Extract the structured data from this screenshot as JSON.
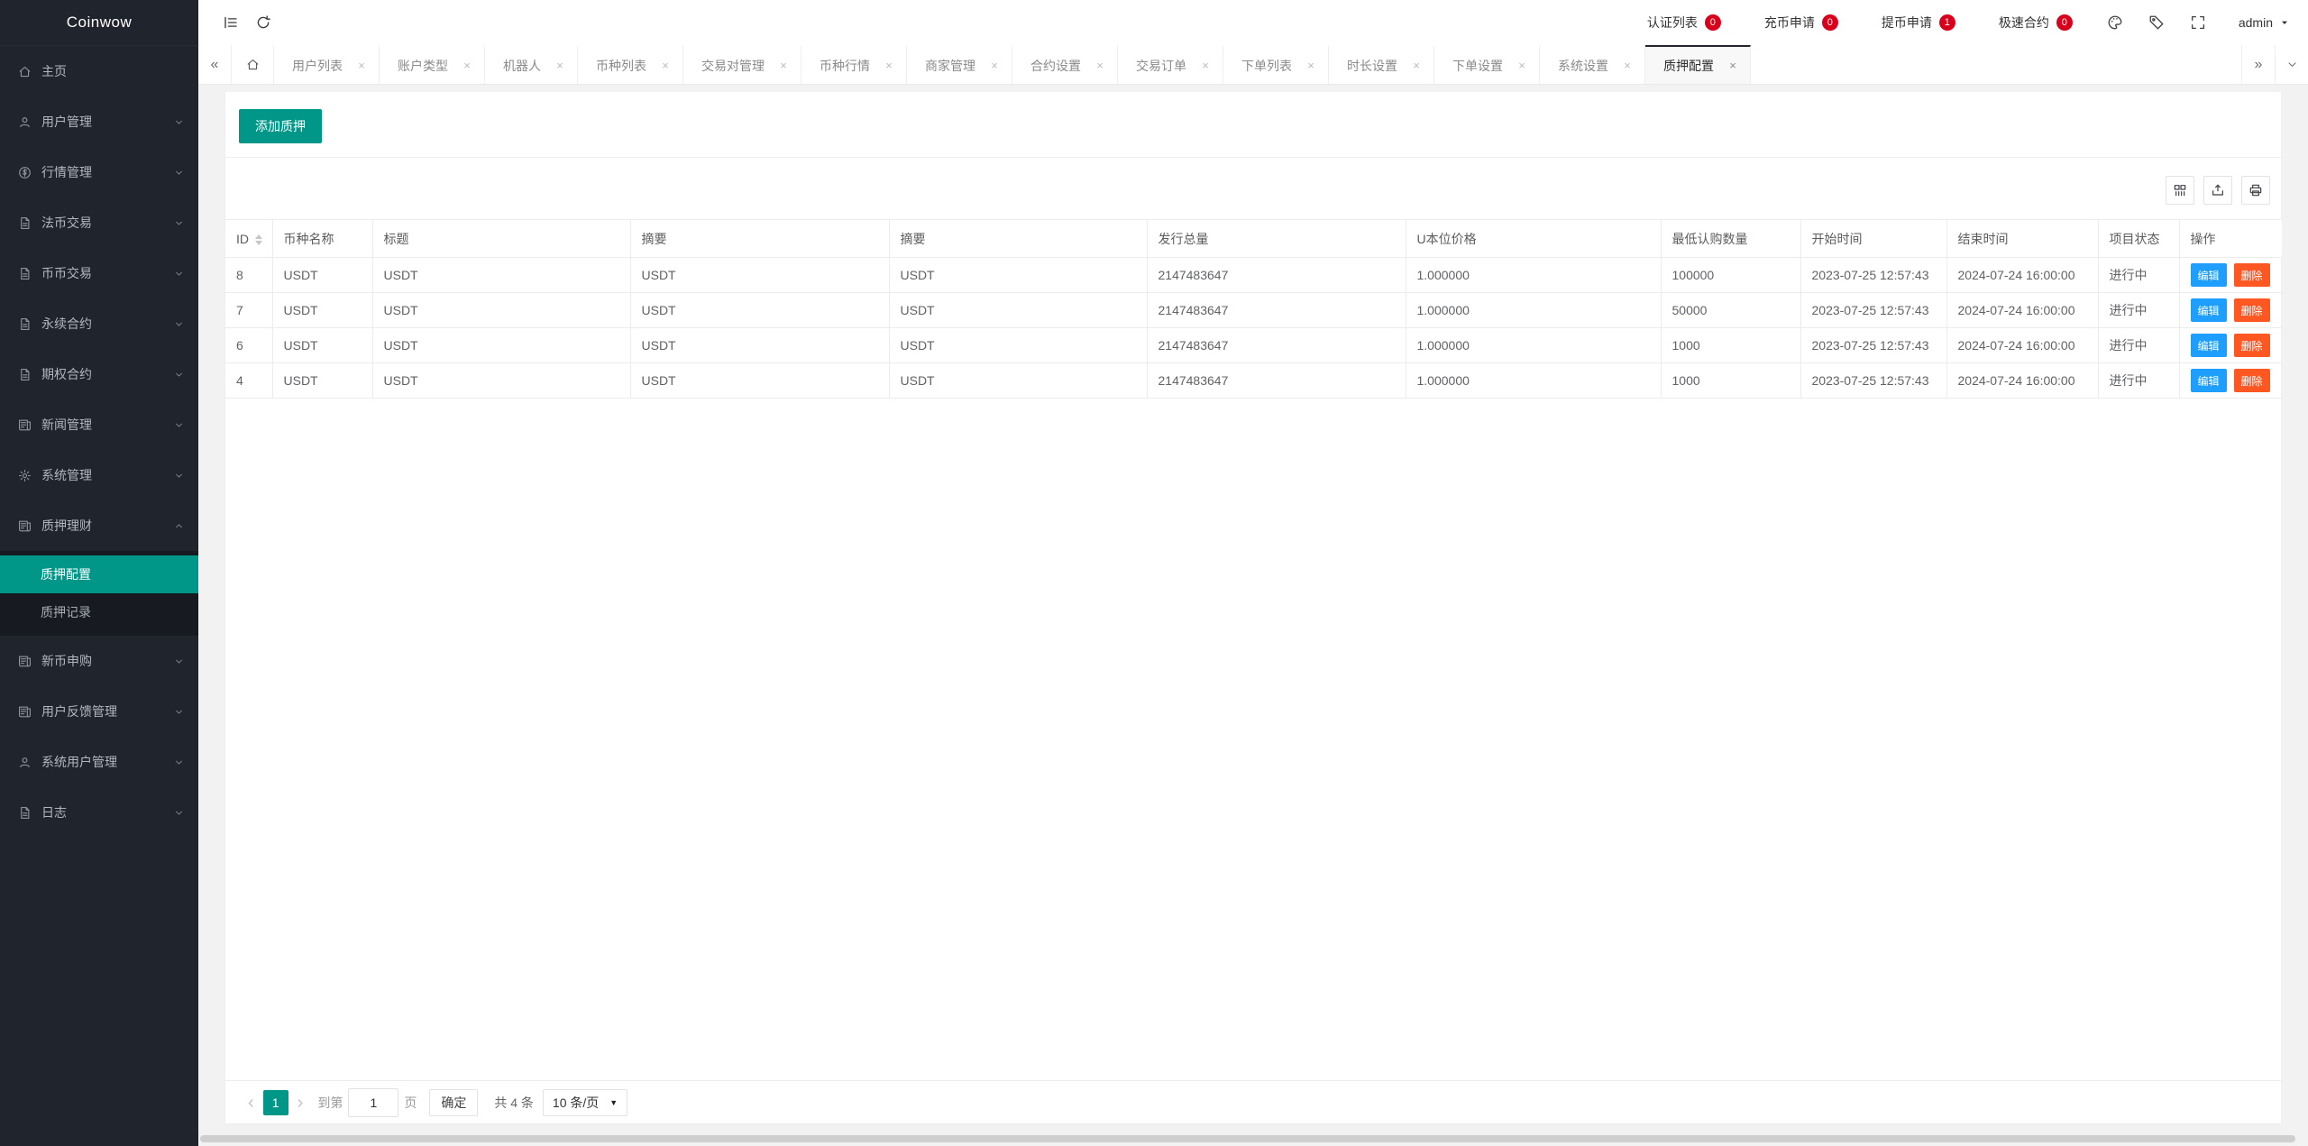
{
  "colors": {
    "accent": "#009688",
    "edit_button": "#1E9FFF",
    "delete_button": "#FF5722",
    "badge": "#d9001b",
    "sidebar_bg": "#20242c"
  },
  "sidebar": {
    "logo": "Coinwow",
    "items": [
      {
        "label": "主页",
        "icon": "home-icon",
        "expandable": false
      },
      {
        "label": "用户管理",
        "icon": "user-icon",
        "expandable": true
      },
      {
        "label": "行情管理",
        "icon": "dollar-circle-icon",
        "expandable": true
      },
      {
        "label": "法币交易",
        "icon": "file-icon",
        "expandable": true
      },
      {
        "label": "币币交易",
        "icon": "file-icon",
        "expandable": true
      },
      {
        "label": "永续合约",
        "icon": "file-icon",
        "expandable": true
      },
      {
        "label": "期权合约",
        "icon": "file-icon",
        "expandable": true
      },
      {
        "label": "新闻管理",
        "icon": "news-icon",
        "expandable": true
      },
      {
        "label": "系统管理",
        "icon": "gear-icon",
        "expandable": true
      },
      {
        "label": "质押理财",
        "icon": "news-icon",
        "expandable": true,
        "expanded": true,
        "children": [
          {
            "label": "质押配置",
            "active": true
          },
          {
            "label": "质押记录",
            "active": false
          }
        ]
      },
      {
        "label": "新币申购",
        "icon": "news-icon",
        "expandable": true
      },
      {
        "label": "用户反馈管理",
        "icon": "news-icon",
        "expandable": true
      },
      {
        "label": "系统用户管理",
        "icon": "user-icon",
        "expandable": true
      },
      {
        "label": "日志",
        "icon": "file-icon",
        "expandable": true
      }
    ]
  },
  "topbar": {
    "left_icons": [
      "collapse-menu-icon",
      "refresh-icon"
    ],
    "shortcuts": [
      {
        "label": "认证列表",
        "badge": "0"
      },
      {
        "label": "充币申请",
        "badge": "0"
      },
      {
        "label": "提币申请",
        "badge": "1"
      },
      {
        "label": "极速合约",
        "badge": "0"
      }
    ],
    "right_icons": [
      "palette-icon",
      "tag-icon",
      "fullscreen-icon"
    ],
    "user": {
      "name": "admin",
      "caret_icon": "caret-down-icon"
    }
  },
  "tabbar": {
    "scroll_left_icon": "chevrons-left-icon",
    "home_icon": "home-icon",
    "scroll_right_icon": "chevrons-right-icon",
    "menu_icon": "chevron-down-icon",
    "tabs": [
      {
        "label": "用户列表",
        "active": false,
        "closable": true
      },
      {
        "label": "账户类型",
        "active": false,
        "closable": true
      },
      {
        "label": "机器人",
        "active": false,
        "closable": true
      },
      {
        "label": "币种列表",
        "active": false,
        "closable": true
      },
      {
        "label": "交易对管理",
        "active": false,
        "closable": true
      },
      {
        "label": "币种行情",
        "active": false,
        "closable": true
      },
      {
        "label": "商家管理",
        "active": false,
        "closable": true
      },
      {
        "label": "合约设置",
        "active": false,
        "closable": true
      },
      {
        "label": "交易订单",
        "active": false,
        "closable": true
      },
      {
        "label": "下单列表",
        "active": false,
        "closable": true
      },
      {
        "label": "时长设置",
        "active": false,
        "closable": true
      },
      {
        "label": "下单设置",
        "active": false,
        "closable": true
      },
      {
        "label": "系统设置",
        "active": false,
        "closable": true
      },
      {
        "label": "质押配置",
        "active": true,
        "closable": true
      }
    ]
  },
  "content": {
    "add_button": "添加质押",
    "table_toolbar_icons": [
      "columns-icon",
      "export-icon",
      "print-icon"
    ],
    "table": {
      "columns": [
        "ID",
        "币种名称",
        "标题",
        "摘要",
        "摘要",
        "发行总量",
        "U本位价格",
        "最低认购数量",
        "开始时间",
        "结束时间",
        "项目状态",
        "操作"
      ],
      "sortable_column": "ID",
      "rows": [
        {
          "cells": [
            "8",
            "USDT",
            "USDT",
            "USDT",
            "USDT",
            "2147483647",
            "1.000000",
            "100000",
            "2023-07-25 12:57:43",
            "2024-07-24 16:00:00",
            "进行中"
          ]
        },
        {
          "cells": [
            "7",
            "USDT",
            "USDT",
            "USDT",
            "USDT",
            "2147483647",
            "1.000000",
            "50000",
            "2023-07-25 12:57:43",
            "2024-07-24 16:00:00",
            "进行中"
          ]
        },
        {
          "cells": [
            "6",
            "USDT",
            "USDT",
            "USDT",
            "USDT",
            "2147483647",
            "1.000000",
            "1000",
            "2023-07-25 12:57:43",
            "2024-07-24 16:00:00",
            "进行中"
          ]
        },
        {
          "cells": [
            "4",
            "USDT",
            "USDT",
            "USDT",
            "USDT",
            "2147483647",
            "1.000000",
            "1000",
            "2023-07-25 12:57:43",
            "2024-07-24 16:00:00",
            "进行中"
          ]
        }
      ],
      "row_actions": [
        {
          "label": "编辑",
          "type": "edit"
        },
        {
          "label": "删除",
          "type": "delete"
        }
      ]
    },
    "pagination": {
      "page": "1",
      "goto_prefix": "到第",
      "goto_value": "1",
      "goto_suffix": "页",
      "confirm": "确定",
      "total": "共 4 条",
      "page_size": "10 条/页"
    }
  }
}
